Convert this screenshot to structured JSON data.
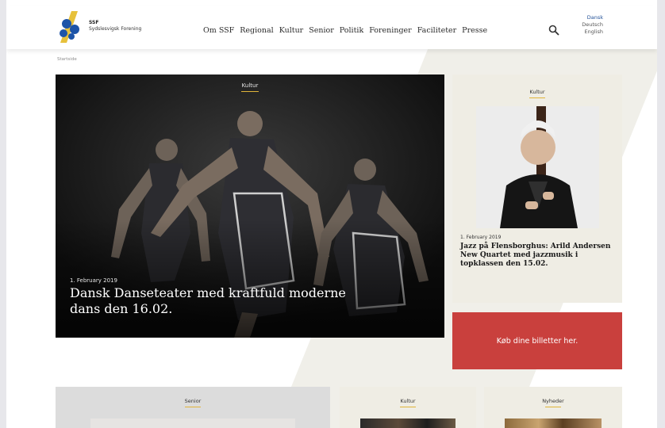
{
  "logo": {
    "abbr": "SSF",
    "name": "Sydslesvigsk Forening"
  },
  "nav": {
    "items": [
      "Om SSF",
      "Regional",
      "Kultur",
      "Senior",
      "Politik",
      "Foreninger",
      "Faciliteter",
      "Presse"
    ]
  },
  "languages": {
    "items": [
      "Dansk",
      "Deutsch",
      "English"
    ],
    "active": "Dansk"
  },
  "breadcrumb": "Startside",
  "hero": {
    "category": "Kultur",
    "date": "1. February 2019",
    "title": "Dansk Danseteater med kraftfuld moderne dans den 16.02."
  },
  "side": {
    "category": "Kultur",
    "date": "1. February 2019",
    "title": "Jazz på Flensborghus: Arild Andersen New Quartet med jazzmusik i topklassen den 15.02."
  },
  "cta": {
    "label": "Køb dine billetter her."
  },
  "cards": [
    {
      "category": "Senior"
    },
    {
      "category": "Kultur"
    },
    {
      "category": "Nyheder"
    }
  ],
  "colors": {
    "accent": "#e0b43a",
    "cta": "#c9403d",
    "card_bg": "#efede4",
    "link": "#1f4e96"
  }
}
